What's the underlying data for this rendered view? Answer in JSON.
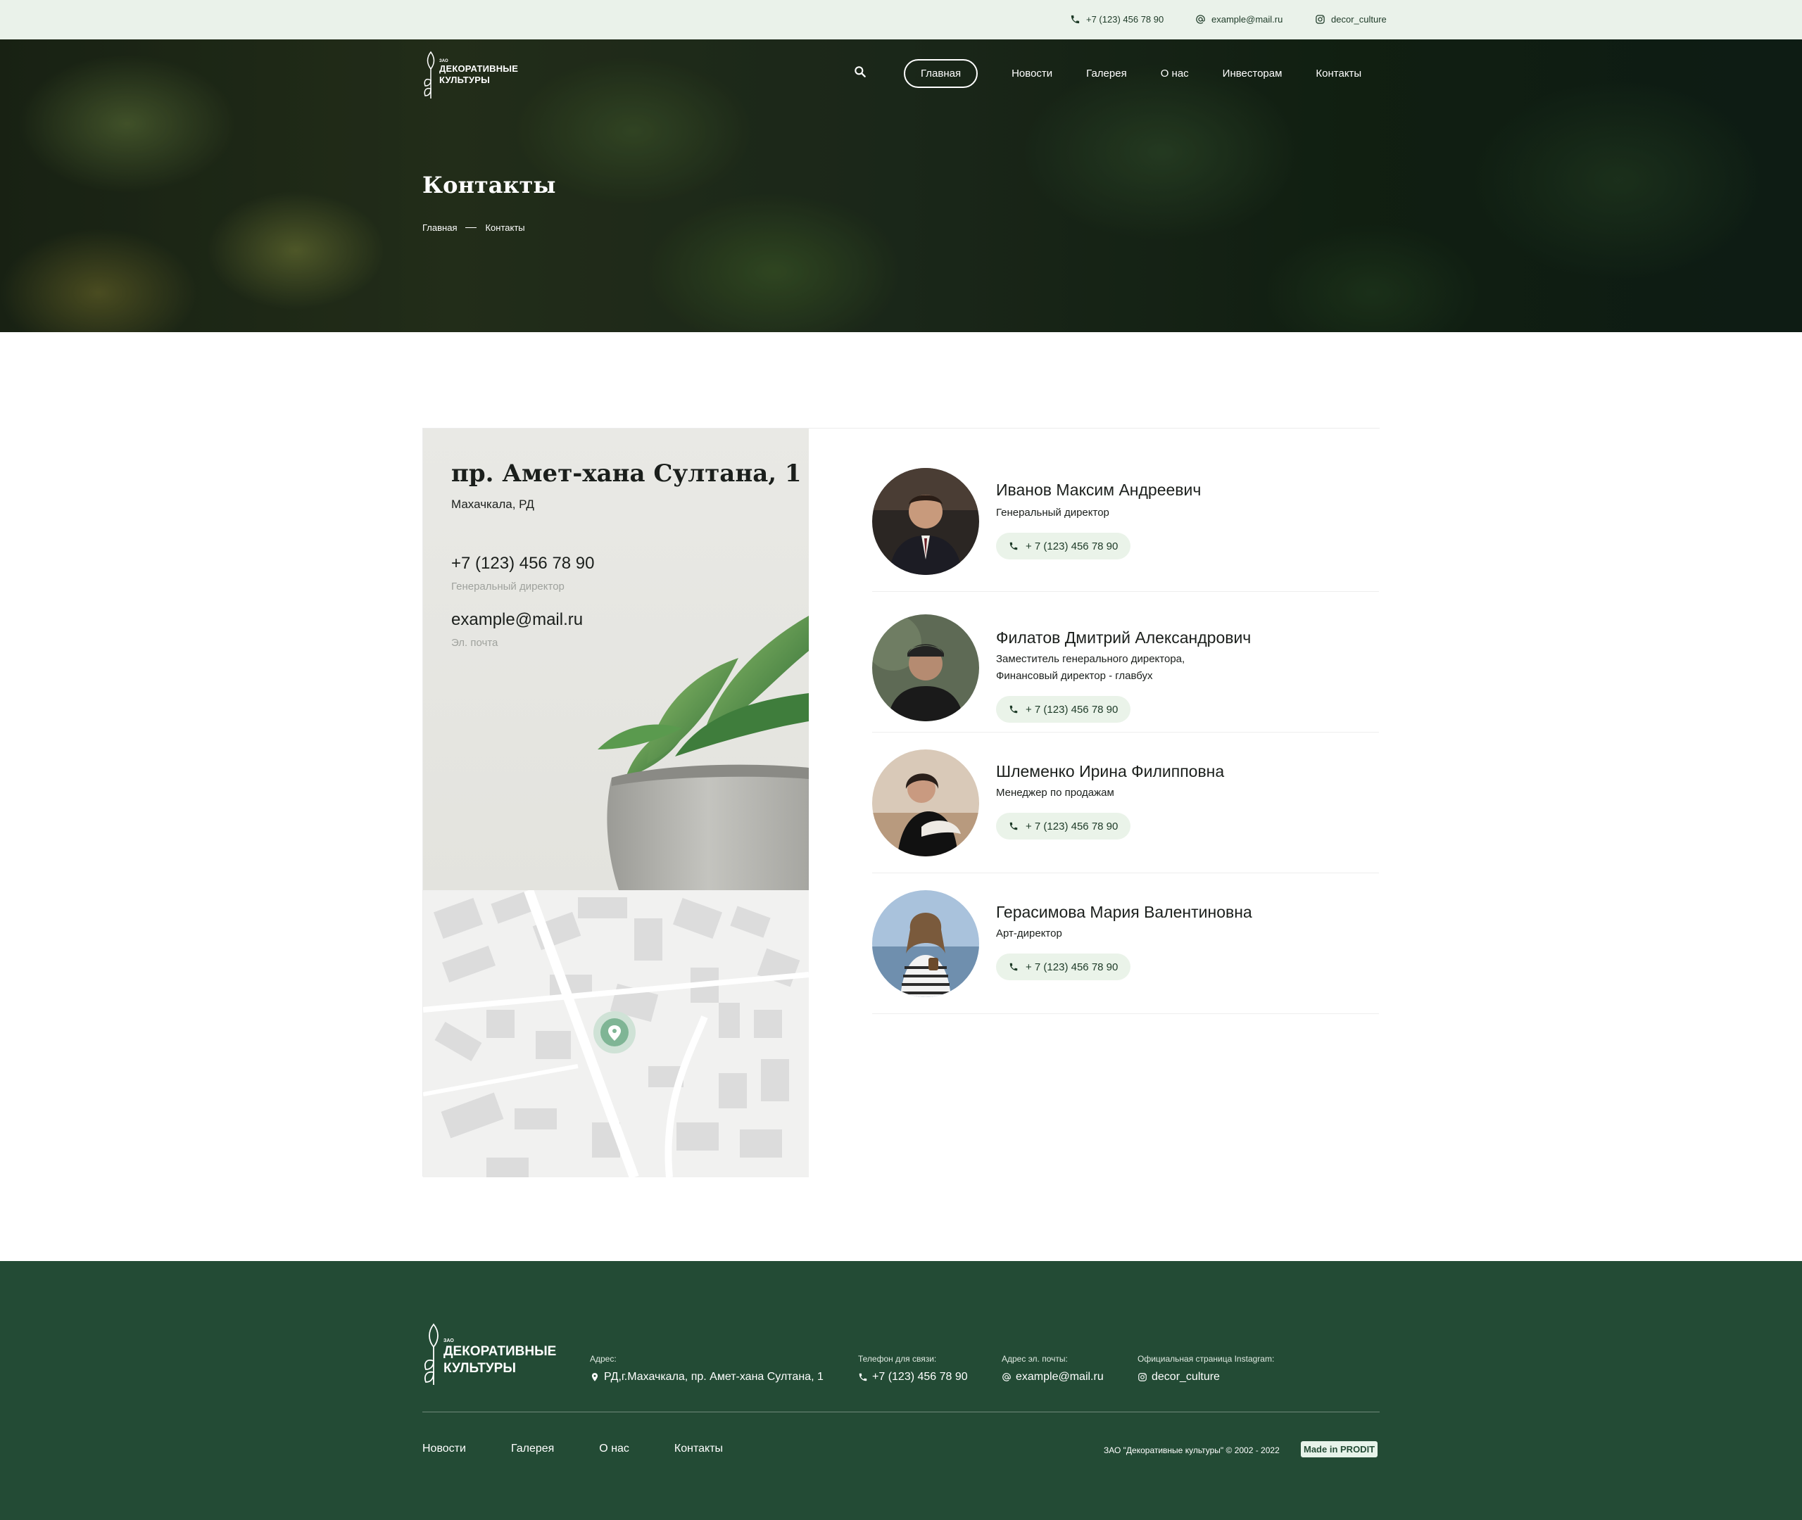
{
  "topbar": {
    "phone": "+7 (123) 456 78 90",
    "email": "example@mail.ru",
    "instagram": "decor_culture"
  },
  "brand": {
    "small": "ЗАО",
    "line1": "ДЕКОРАТИВНЫЕ",
    "line2": "КУЛЬТУРЫ"
  },
  "nav": {
    "items": [
      {
        "label": "Главная",
        "active": true
      },
      {
        "label": "Новости"
      },
      {
        "label": "Галерея"
      },
      {
        "label": "О нас"
      },
      {
        "label": "Инвесторам"
      },
      {
        "label": "Контакты"
      }
    ]
  },
  "hero": {
    "title": "Контакты",
    "breadcrumb": [
      "Главная",
      "Контакты"
    ]
  },
  "office": {
    "address": "пр. Амет-хана Султана, 1",
    "city": "Махачкала, РД",
    "phone": "+7 (123) 456 78 90",
    "phone_caption": "Генеральный директор",
    "email": "example@mail.ru",
    "email_caption": "Эл. почта"
  },
  "people": [
    {
      "name": "Иванов Максим Андреевич",
      "role1": "Генеральный директор",
      "role2": "",
      "phone": "+ 7 (123) 456 78 90"
    },
    {
      "name": "Филатов Дмитрий Александрович",
      "role1": "Заместитель генерального директора,",
      "role2": "Финансовый директор - главбух",
      "phone": "+ 7 (123) 456 78 90"
    },
    {
      "name": "Шлеменко Ирина Филипповна",
      "role1": "Менеджер по продажам",
      "role2": "",
      "phone": "+ 7 (123) 456 78 90"
    },
    {
      "name": "Герасимова Мария Валентиновна",
      "role1": "Арт-директор",
      "role2": "",
      "phone": "+ 7 (123) 456 78 90"
    }
  ],
  "footer": {
    "address_caption": "Адрес:",
    "address": "РД,г.Махачкала, пр. Амет-хана Султана, 1",
    "phone_caption": "Телефон для связи:",
    "phone": "+7 (123) 456 78 90",
    "email_caption": "Адрес эл. почты:",
    "email": "example@mail.ru",
    "instagram_caption": "Официальная страница Instagram:",
    "instagram": "decor_culture",
    "nav": [
      "Новости",
      "Галерея",
      "О нас",
      "Контакты"
    ],
    "copyright": "ЗАО \"Декоративные культуры\" © 2002 - 2022",
    "made_in": "Made in PRODIT"
  },
  "colors": {
    "accent_dark": "#234b35",
    "topbar_bg": "#eaf2ea",
    "phone_pill_bg": "#eaf3e9",
    "map_pin": "#7fb595"
  },
  "icons": [
    "phone-icon",
    "at-icon",
    "instagram-icon",
    "search-icon",
    "leaf-logo-icon",
    "map-pin-icon"
  ]
}
